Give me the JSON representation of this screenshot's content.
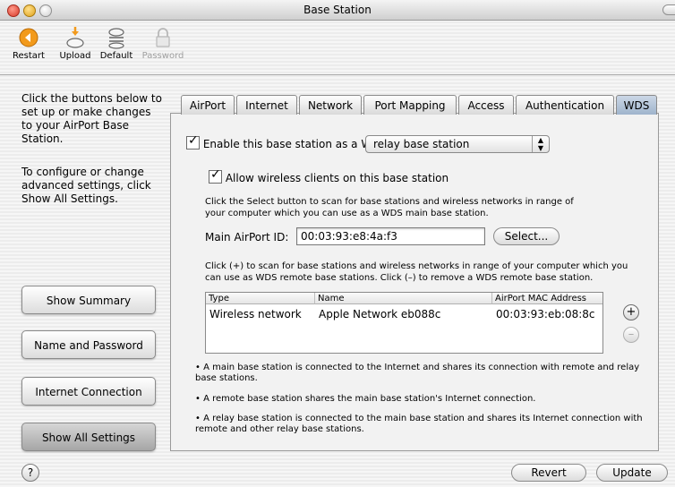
{
  "window": {
    "title": "Base Station"
  },
  "toolbar": {
    "items": [
      {
        "label": "Restart",
        "icon": "restart-icon",
        "enabled": true
      },
      {
        "label": "Upload",
        "icon": "upload-icon",
        "enabled": true
      },
      {
        "label": "Default",
        "icon": "default-icon",
        "enabled": true
      },
      {
        "label": "Password",
        "icon": "lock-icon",
        "enabled": false
      }
    ]
  },
  "sidebar": {
    "intro": "Click the buttons below to set up or make changes to your AirPort Base Station.",
    "configure": "To configure or change advanced settings, click Show All Settings.",
    "buttons": [
      {
        "label": "Show Summary"
      },
      {
        "label": "Name and Password"
      },
      {
        "label": "Internet Connection"
      },
      {
        "label": "Show All Settings",
        "active": true
      }
    ]
  },
  "tabs": [
    {
      "label": "AirPort"
    },
    {
      "label": "Internet"
    },
    {
      "label": "Network"
    },
    {
      "label": "Port Mapping"
    },
    {
      "label": "Access"
    },
    {
      "label": "Authentication"
    },
    {
      "label": "WDS",
      "selected": true
    }
  ],
  "wds": {
    "enable_label": "Enable this base station as a WDS",
    "enable_checked": true,
    "mode_value": "relay base station",
    "allow_label": "Allow wireless clients on this base station",
    "allow_checked": true,
    "select_info": "Click the Select button to scan for base stations and wireless networks in range of your computer which you can use as a WDS main base station.",
    "main_id_label": "Main AirPort ID:",
    "main_id_value": "00:03:93:e8:4a:f3",
    "select_button": "Select...",
    "remote_info": "Click (+) to scan for base stations and wireless networks in range of your computer which you can use as WDS remote base stations. Click (–) to remove a WDS remote base station.",
    "table": {
      "columns": [
        "Type",
        "Name",
        "AirPort MAC Address"
      ],
      "rows": [
        [
          "Wireless network",
          "Apple Network eb088c",
          "00:03:93:eb:08:8c"
        ]
      ]
    },
    "add_button": "+",
    "remove_button": "–",
    "notes": [
      "• A main base station is connected to the Internet and shares its connection with remote and relay base stations.",
      "• A remote base station shares the main base station's Internet connection.",
      "• A relay base station is connected to the main base station and shares its Internet connection with remote and other relay base stations."
    ]
  },
  "footer": {
    "help": "?",
    "revert": "Revert",
    "update": "Update"
  }
}
